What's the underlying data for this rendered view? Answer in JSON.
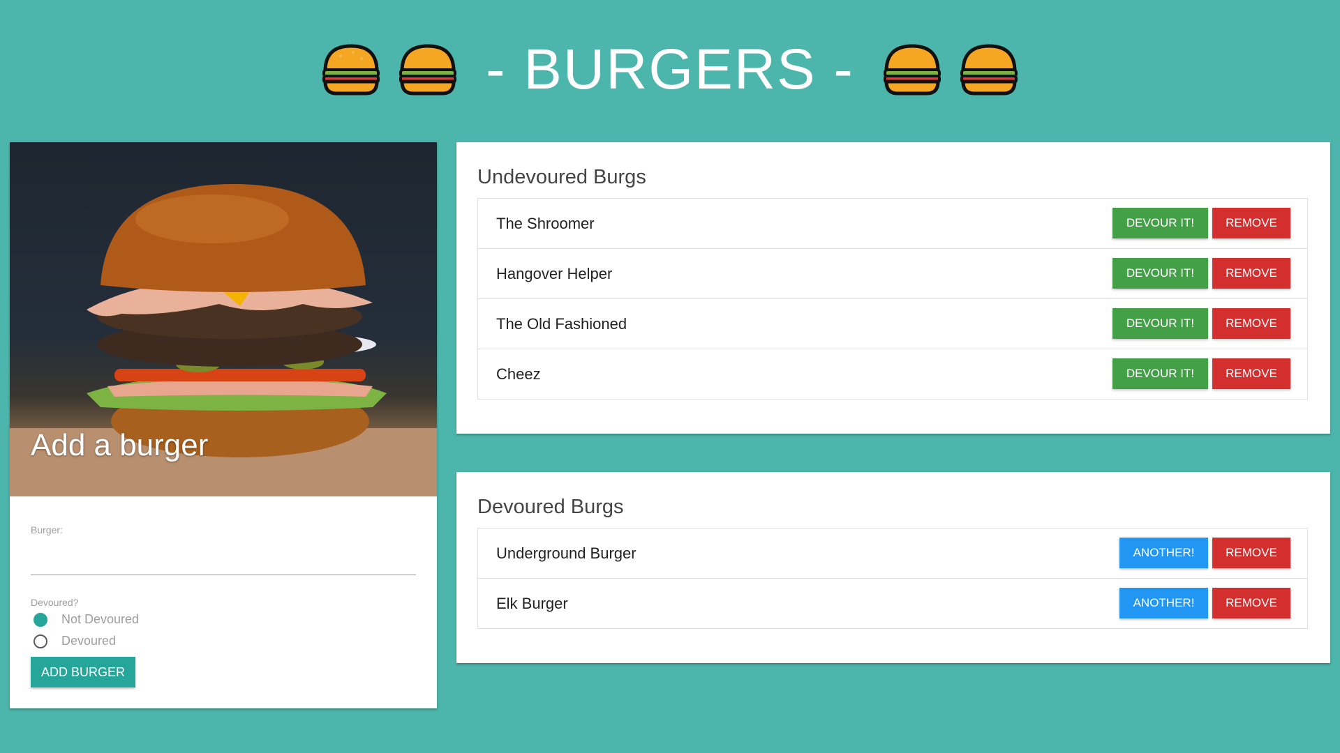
{
  "header": {
    "title": "- BURGERS -",
    "emoji_icon": "burger-icon"
  },
  "add_form": {
    "image_title": "Add a burger",
    "burger_label": "Burger:",
    "burger_value": "",
    "devoured_label": "Devoured?",
    "options": [
      {
        "label": "Not Devoured",
        "checked": true
      },
      {
        "label": "Devoured",
        "checked": false
      }
    ],
    "submit_label": "ADD BURGER"
  },
  "undevoured": {
    "heading": "Undevoured Burgs",
    "items": [
      {
        "name": "The Shroomer"
      },
      {
        "name": "Hangover Helper"
      },
      {
        "name": "The Old Fashioned"
      },
      {
        "name": "Cheez"
      }
    ],
    "devour_label": "DEVOUR IT!",
    "remove_label": "REMOVE"
  },
  "devoured": {
    "heading": "Devoured Burgs",
    "items": [
      {
        "name": "Underground Burger"
      },
      {
        "name": "Elk Burger"
      }
    ],
    "another_label": "ANOTHER!",
    "remove_label": "REMOVE"
  },
  "colors": {
    "background": "#4db6ac",
    "teal": "#26a69a",
    "green": "#43a047",
    "blue": "#2196f3",
    "red": "#d32f2f"
  }
}
